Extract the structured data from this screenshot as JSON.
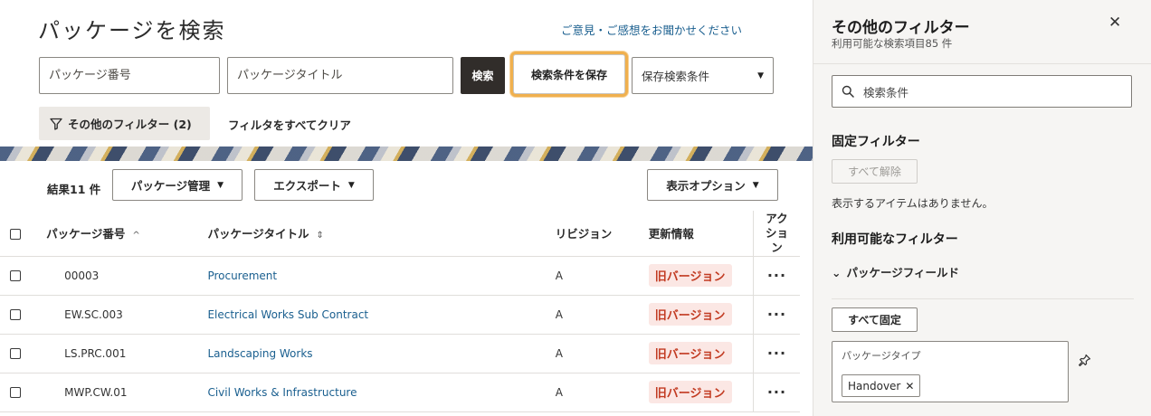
{
  "header": {
    "title": "パッケージを検索",
    "feedback_link": "ご意見・ご感想をお聞かせください"
  },
  "search": {
    "package_number_placeholder": "パッケージ番号",
    "package_title_placeholder": "パッケージタイトル",
    "search_button": "検索",
    "save_criteria_button": "検索条件を保存",
    "saved_search_label": "保存検索条件"
  },
  "filters": {
    "more_filters_label": "その他のフィルター (2)",
    "clear_all_label": "フィルタをすべてクリア"
  },
  "toolbar": {
    "results_label": "結果11 件",
    "package_management": "パッケージ管理",
    "export": "エクスポート",
    "view_options": "表示オプション"
  },
  "table": {
    "columns": {
      "number": "パッケージ番号",
      "title": "パッケージタイトル",
      "revision": "リビジョン",
      "update": "更新情報",
      "actions": "アクション"
    },
    "rows": [
      {
        "number": "00003",
        "title": "Procurement",
        "revision": "A",
        "update": "旧バージョン"
      },
      {
        "number": "EW.SC.003",
        "title": "Electrical Works Sub Contract",
        "revision": "A",
        "update": "旧バージョン"
      },
      {
        "number": "LS.PRC.001",
        "title": "Landscaping Works",
        "revision": "A",
        "update": "旧バージョン"
      },
      {
        "number": "MWP.CW.01",
        "title": "Civil Works & Infrastructure",
        "revision": "A",
        "update": "旧バージョン"
      }
    ],
    "row_action_glyph": "···"
  },
  "panel": {
    "title": "その他のフィルター",
    "subtitle": "利用可能な検索項目85 件",
    "search_placeholder": "検索条件",
    "pinned_heading": "固定フィルター",
    "unpin_all": "すべて解除",
    "no_items": "表示するアイテムはありません。",
    "available_heading": "利用可能なフィルター",
    "package_fields": "パッケージフィールド",
    "pin_all": "すべて固定",
    "package_type_label": "パッケージタイプ",
    "package_type_token": "Handover"
  },
  "colors": {
    "accent_link": "#1a5f8f",
    "highlight_outline": "#f0b04e",
    "badge_text": "#c23b22",
    "badge_bg": "#fbe7e4",
    "primary_button": "#312d2a"
  }
}
